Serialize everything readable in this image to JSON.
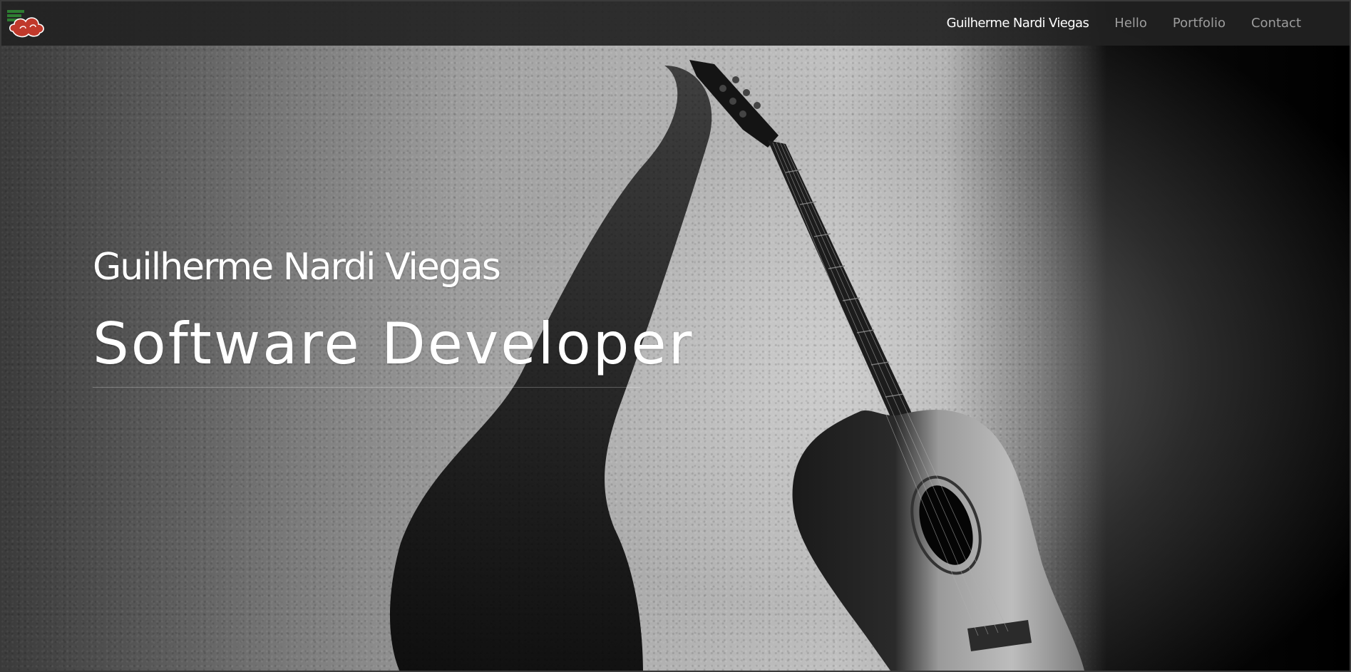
{
  "navbar": {
    "logo_icon": "red-cloud-logo-icon",
    "links": [
      {
        "label": "Guilherme Nardi Viegas",
        "active": true
      },
      {
        "label": "Hello",
        "active": false
      },
      {
        "label": "Portfolio",
        "active": false
      },
      {
        "label": "Contact",
        "active": false
      }
    ]
  },
  "hero": {
    "name": "Guilherme Nardi Viegas",
    "role": "Software Developer",
    "background_icon": "guitar-against-wall-photo"
  },
  "colors": {
    "navbar_bg": "#222222",
    "nav_active": "#ffffff",
    "nav_inactive": "#9d9d9d",
    "hero_text": "#ffffff",
    "logo_red": "#c0392b"
  }
}
